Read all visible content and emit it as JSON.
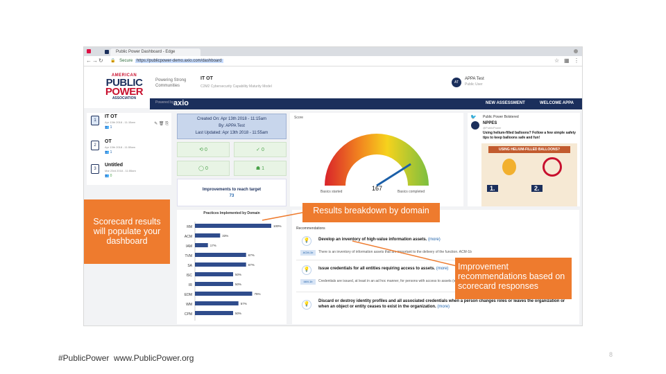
{
  "browser": {
    "tab_title": "Public Power Dashboard - Edge",
    "url_prefix": "Secure",
    "url": "https://publicpower-demo.axio.com/dashboard"
  },
  "header": {
    "logo": {
      "line1": "AMERICAN",
      "line2": "PUBLIC",
      "line3": "POWER",
      "line4": "ASSOCIATION"
    },
    "org_name": "Powering Strong Communities",
    "assessment_title": "IT OT",
    "assessment_subtitle": "C2M2 Cybersecurity Capability Maturity Model",
    "user_initials": "AT",
    "user_name": "APPA Test",
    "user_sub": "Public User"
  },
  "nav": {
    "powered_by": "Powered by",
    "brand": "axio",
    "new_assessment": "NEW ASSESSMENT",
    "welcome": "WELCOME APPA"
  },
  "assessments": [
    {
      "num": "1",
      "name": "IT OT",
      "date": "Apr 13th 2018 - 11:15am",
      "meta": "1",
      "active": true
    },
    {
      "num": "2",
      "name": "OT",
      "date": "Apr 13th 2018 - 11:59am",
      "meta": "1",
      "active": false
    },
    {
      "num": "3",
      "name": "Untitled",
      "date": "Mar 23rd 2018 - 11:55am",
      "meta": "0",
      "active": false
    }
  ],
  "created": {
    "created_on": "Created On: Apr 13th 2018 - 11:15am",
    "by": "By: APPA Test",
    "last_updated": "Last Updated: Apr 13th 2018 - 11:55am"
  },
  "stats": [
    {
      "icon": "⟲",
      "value": "0"
    },
    {
      "icon": "✓",
      "value": "0"
    },
    {
      "icon": "◯",
      "value": "0"
    },
    {
      "icon": "☗",
      "value": "1"
    }
  ],
  "improvements": {
    "label": "Improvements to reach target",
    "value": "73"
  },
  "score": {
    "title": "Score",
    "value": "167",
    "left_label": "Basics started",
    "right_label": "Basics completed",
    "fraction": 0.82
  },
  "twitter": {
    "account": "Public Power Bolstered",
    "handle": "NPPES",
    "handle_sub": "@PublicPower",
    "text": "Using helium-filled balloons? Follow a few simple safety tips to keep balloons safe and fun!",
    "banner": "USING HELIUM-FILLED BALLOONS?",
    "step1": "1.",
    "step2": "2."
  },
  "chart_data": {
    "type": "bar",
    "title": "Practices Implemented by Domain",
    "categories": [
      "RM",
      "ACM",
      "IAM",
      "TVM",
      "SA",
      "ISC",
      "IR",
      "EDM",
      "WM",
      "CPM"
    ],
    "values": [
      100,
      33,
      17,
      67,
      67,
      50,
      50,
      75,
      57,
      50
    ],
    "value_labels": [
      "100%",
      "33%",
      "17%",
      "67%",
      "67%",
      "50%",
      "50%",
      "75%",
      "57%",
      "50%"
    ],
    "xlim": [
      0,
      100
    ],
    "color": "#2f4c8c"
  },
  "recommendations": {
    "heading": "Recommendations",
    "items": [
      {
        "id": "ACM-1b",
        "title": "Develop an inventory of high-value information assets.",
        "more": "(more)",
        "text": "There is an inventory of information assets that are important to the delivery of the function. ACM-1b"
      },
      {
        "id": "IAM-1b",
        "title": "Issue credentials for all entities requiring access to assets.",
        "more": "(more)",
        "text": "Credentials are issued, at least in an ad hoc manner, for persons with access to assets (e.g., passwords, smart cards, certificates, keys)"
      },
      {
        "id": "",
        "title": "Discard or destroy identity profiles and all associated credentials when a person changes roles or leaves the organization or when an object or entity ceases to exist in the organization.",
        "more": "(more)",
        "text": ""
      }
    ]
  },
  "callouts": {
    "scorecard": "Scorecard results will populate your dashboard",
    "breakdown": "Results breakdown by domain",
    "improvement": "Improvement recommendations based on scorecard responses"
  },
  "footer": {
    "hashtag": "#PublicPower",
    "site": "www.PublicPower.org",
    "page": "8"
  },
  "colors": {
    "navy": "#1b2f5c",
    "orange": "#ee7b2e",
    "red": "#c8102e",
    "green": "#4aa24a"
  }
}
